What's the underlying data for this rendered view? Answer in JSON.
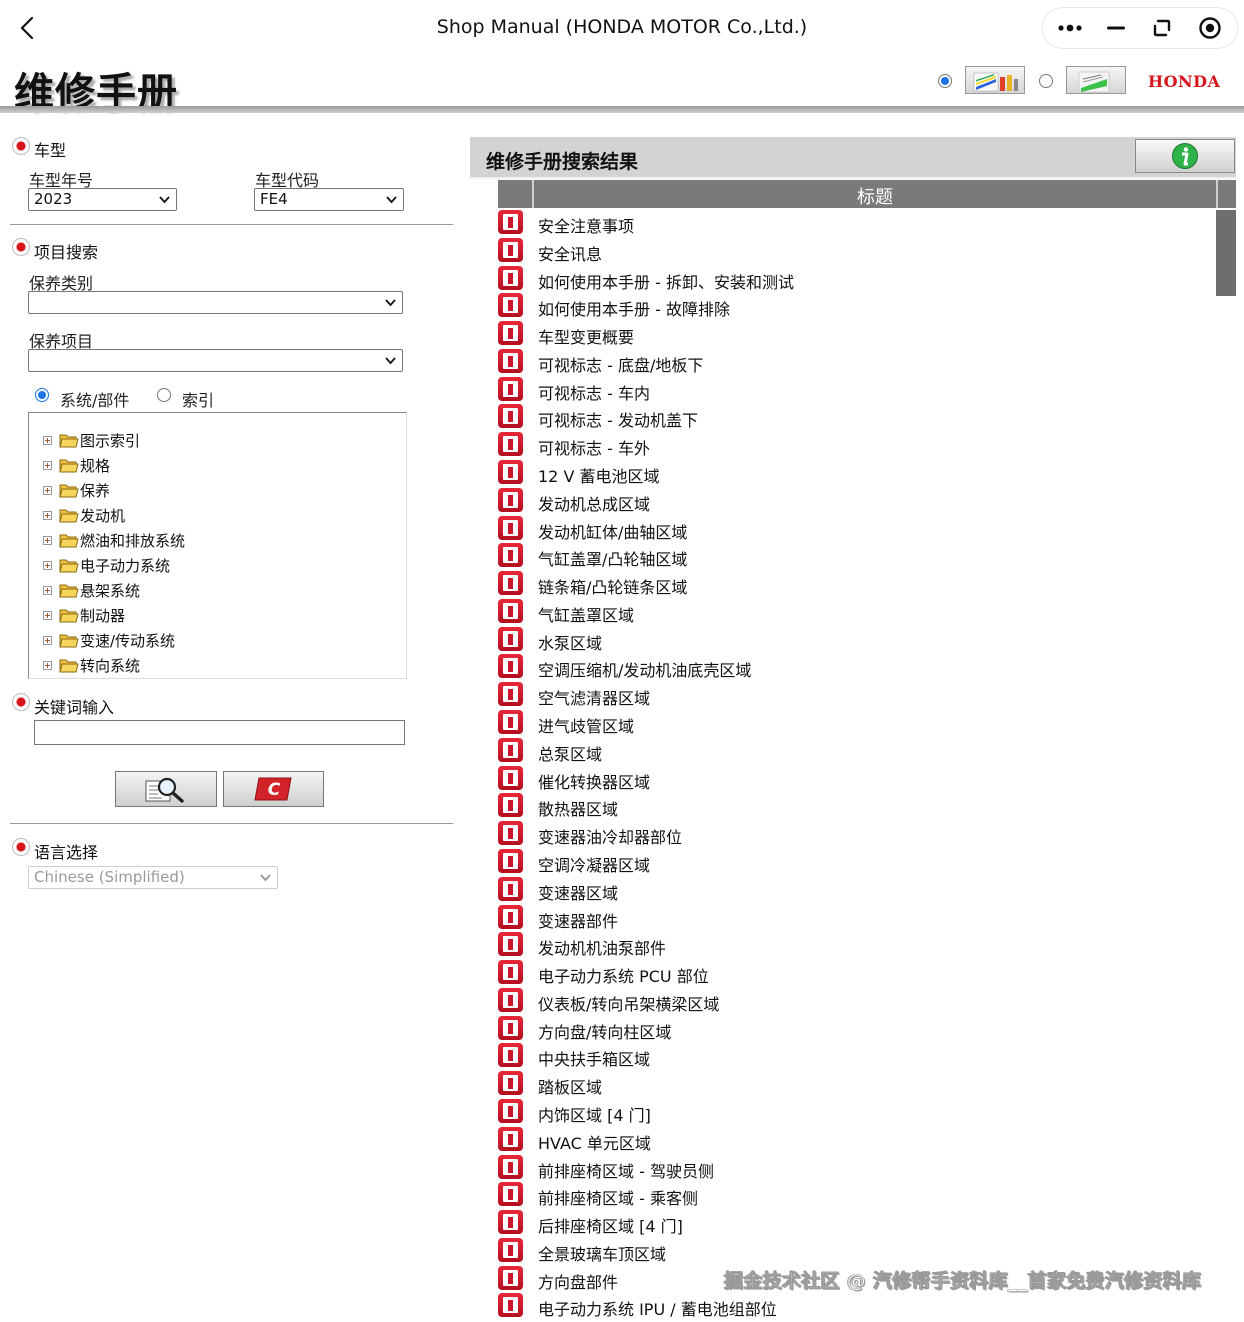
{
  "topbar": {
    "title": "Shop Manual (HONDA MOTOR Co.,Ltd.)",
    "icons": [
      "back-arrow-icon",
      "more-dots-icon",
      "minimize-icon",
      "restore-icon",
      "close-target-icon"
    ]
  },
  "header": {
    "manual_title": "维修手册",
    "brand": "HONDA",
    "view_options": [
      {
        "icon": "colored-manual-view-icon",
        "selected": true
      },
      {
        "icon": "green-manual-view-icon",
        "selected": false
      }
    ]
  },
  "vehicle": {
    "section_label": "车型",
    "year_label": "车型年号",
    "year_value": "2023",
    "code_label": "车型代码",
    "code_value": "FE4"
  },
  "item_search": {
    "section_label": "项目搜索",
    "category_label": "保养类别",
    "category_value": "",
    "item_label": "保养项目",
    "item_value": "",
    "mode_system": "系统/部件",
    "mode_index": "索引",
    "selected_mode": "system"
  },
  "tree": {
    "items": [
      "图示索引",
      "规格",
      "保养",
      "发动机",
      "燃油和排放系统",
      "电子动力系统",
      "悬架系统",
      "制动器",
      "变速/传动系统",
      "转向系统"
    ]
  },
  "keyword": {
    "section_label": "关键词输入",
    "value": "",
    "search_icon": "magnifier-search-icon",
    "clear_icon": "clear-c-icon"
  },
  "language": {
    "section_label": "语言选择",
    "value": "Chinese (Simplified)"
  },
  "results": {
    "title": "维修手册搜索结果",
    "info_icon": "info-icon",
    "column_title": "标题",
    "rows": [
      "安全注意事项",
      "安全讯息",
      "如何使用本手册 - 拆卸、安装和测试",
      "如何使用本手册 - 故障排除",
      "车型变更概要",
      "可视标志 - 底盘/地板下",
      "可视标志 - 车内",
      "可视标志 - 发动机盖下",
      "可视标志 - 车外",
      "12 V 蓄电池区域",
      "发动机总成区域",
      "发动机缸体/曲轴区域",
      "气缸盖罩/凸轮轴区域",
      "链条箱/凸轮链条区域",
      "气缸盖罩区域",
      "水泵区域",
      "空调压缩机/发动机油底壳区域",
      "空气滤清器区域",
      "进气歧管区域",
      "总泵区域",
      "催化转换器区域",
      "散热器区域",
      "变速器油冷却器部位",
      "空调冷凝器区域",
      "变速器区域",
      "变速器部件",
      "发动机机油泵部件",
      "电子动力系统 PCU 部位",
      "仪表板/转向吊架横梁区域",
      "方向盘/转向柱区域",
      "中央扶手箱区域",
      "踏板区域",
      "内饰区域 [4 门]",
      "HVAC 单元区域",
      "前排座椅区域 - 驾驶员侧",
      "前排座椅区域 - 乘客侧",
      "后排座椅区域 [4 门]",
      "全景玻璃车顶区域",
      "方向盘部件",
      "电子动力系统 IPU / 蓄电池组部位"
    ]
  },
  "watermark": "掘金技术社区 @ 汽修帮手资料库__首家免费汽修资料库"
}
